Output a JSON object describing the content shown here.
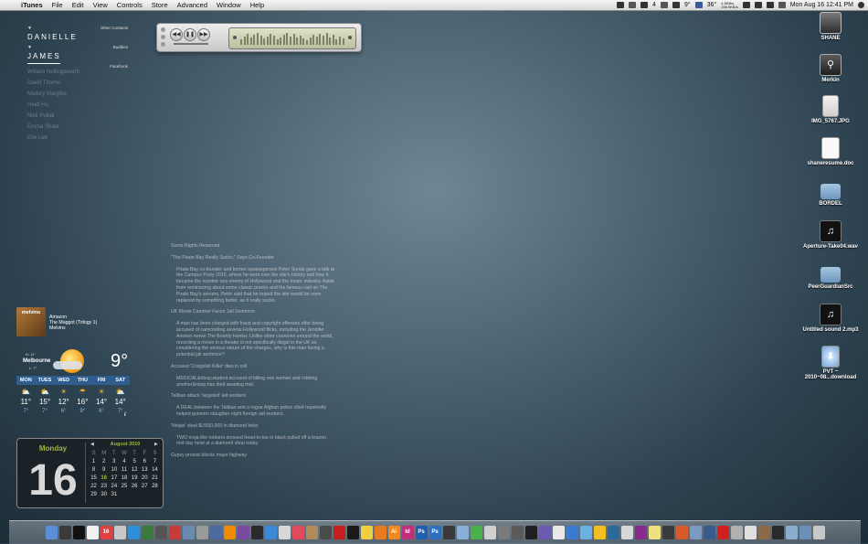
{
  "menubar": {
    "apple": "",
    "app": "iTunes",
    "items": [
      "File",
      "Edit",
      "View",
      "Controls",
      "Store",
      "Advanced",
      "Window",
      "Help"
    ],
    "right": {
      "badge": "4",
      "temp": "9°",
      "cpu": "36°",
      "net_up": "4.5KB/s",
      "net_down": "156.9KB/s",
      "clock": "Mon Aug 16  12:41 PM"
    }
  },
  "itunes_widget": {
    "controls": [
      "prev",
      "pause",
      "next"
    ]
  },
  "left_menu": {
    "names": [
      "DANIELLE",
      "JAMES"
    ],
    "friends": [
      "William Hollingsworth",
      "David Thorne",
      "Mallory Margitta",
      "Heidi Hu",
      "Nick Pollak",
      "Emma Shaw",
      "Eve Lee"
    ],
    "right_col": [
      "Other Contacts",
      "Buddies",
      "Facebook"
    ]
  },
  "news": [
    {
      "type": "h",
      "text": "Some Rights Reserved"
    },
    {
      "type": "h",
      "text": "\"The Pirate Bay Really Sucks,\" Says Co-Founder"
    },
    {
      "type": "b",
      "text": "Pirate Bay co-founder and former spokesperson Peter Sunde gave a talk at the Campus Party 2010, where he went over the site's history and how it became the number one enemy of Hollywood and the music industry. Aside from reminiscing about some classic pranks and the famous raid on The Pirate Bay's servers, Peter said that he hoped the site would be soon replaced by something better, as it really sucks."
    },
    {
      "type": "h",
      "text": "UK Movie Cammer Faces Jail Sentence"
    },
    {
      "type": "b",
      "text": "A man has been charged with fraud and copyright offenses after being accused of camcording several Hollywood flicks, including the Jennifer Aniston movie The Bounty Hunter. Unlike other countries around the world, recording a movie in a theater is not specifically illegal in the UK so considering the serious nature of the charges, why is this man facing a potential jail sentence?"
    },
    {
      "type": "h",
      "text": "Accused 'Craigslist Killer' dies in cell"
    },
    {
      "type": "b",
      "text": "MEDICAL&nbsp;student accused of killing one woman and robbing another&nbsp;has died awaiting trial."
    },
    {
      "type": "h",
      "text": "Taliban attack 'targeted' aid workers"
    },
    {
      "type": "b",
      "text": "A DEAL between the Taliban and a rogue Afghan police chief reportedly helped gunmen slaughter eight foreign aid workers."
    },
    {
      "type": "h",
      "text": "'Ninjas' steal $US60,000 in diamond heist"
    },
    {
      "type": "b",
      "text": "TWO ninja-like robbers dressed head-to-toe in black pulled off a brazen, mid-day heist at a diamond shop today."
    },
    {
      "type": "h",
      "text": "Gypsy protest blocks major highway"
    }
  ],
  "music": {
    "album_art": "melvins",
    "source": "Amazon",
    "album": "The Maggot (Trilogy 1)",
    "artist": "Melvins"
  },
  "weather": {
    "city": "Melbourne",
    "hi": "H: 11°",
    "lo": "L: 7°",
    "temp": "9°",
    "days": [
      "MON",
      "TUES",
      "WED",
      "THU",
      "FRI",
      "SAT"
    ],
    "highs": [
      "11°",
      "15°",
      "12°",
      "16°",
      "14°",
      "14°"
    ],
    "lows": [
      "7°",
      "7°",
      "6°",
      "9°",
      "6°",
      "7°"
    ],
    "icons": [
      "sun-cloud",
      "sun-cloud",
      "sun",
      "rain",
      "sun",
      "sun-cloud"
    ],
    "info": "i"
  },
  "calendar": {
    "day_name": "Monday",
    "day_num": "16",
    "month": "August 2010",
    "headers": [
      "S",
      "M",
      "T",
      "W",
      "T",
      "F",
      "S"
    ],
    "days": [
      "1",
      "2",
      "3",
      "4",
      "5",
      "6",
      "7",
      "8",
      "9",
      "10",
      "11",
      "12",
      "13",
      "14",
      "15",
      "16",
      "17",
      "18",
      "19",
      "20",
      "21",
      "22",
      "23",
      "24",
      "25",
      "26",
      "27",
      "28",
      "29",
      "30",
      "31"
    ],
    "first_weekday": 0,
    "today": "16"
  },
  "desktop_icons": [
    {
      "label": "SHANE",
      "kind": "drive",
      "glyph": ""
    },
    {
      "label": "Merkin",
      "kind": "usb",
      "glyph": "⚲"
    },
    {
      "label": "IMG_5767.JPG",
      "kind": "photo",
      "glyph": ""
    },
    {
      "label": "shaneresume.doc",
      "kind": "doc",
      "glyph": ""
    },
    {
      "label": "BORDEL",
      "kind": "folder",
      "glyph": ""
    },
    {
      "label": "Aperture-Take04.wav",
      "kind": "audio",
      "glyph": "♫"
    },
    {
      "label": "PeerGuardianSrc",
      "kind": "folder",
      "glyph": ""
    },
    {
      "label": "Untitled sound 2.mp3",
      "kind": "audio",
      "glyph": "♫"
    },
    {
      "label": "PVT ~ 2010~08...download",
      "kind": "dl",
      "glyph": "⬇"
    }
  ],
  "dock": {
    "items": [
      {
        "name": "finder",
        "color": "#5a8fd6",
        "glyph": ""
      },
      {
        "name": "dashboard",
        "color": "#3a3a3a",
        "glyph": ""
      },
      {
        "name": "terminal",
        "color": "#111111",
        "glyph": ""
      },
      {
        "name": "textedit",
        "color": "#f0f0f0",
        "glyph": ""
      },
      {
        "name": "ical",
        "color": "#e04040",
        "glyph": "16"
      },
      {
        "name": "app-6",
        "color": "#c8c8c8",
        "glyph": ""
      },
      {
        "name": "app-7",
        "color": "#2e8fd8",
        "glyph": ""
      },
      {
        "name": "app-8",
        "color": "#3a7a3a",
        "glyph": ""
      },
      {
        "name": "app-9",
        "color": "#555555",
        "glyph": ""
      },
      {
        "name": "app-10",
        "color": "#c83a3a",
        "glyph": ""
      },
      {
        "name": "app-11",
        "color": "#6a8ab0",
        "glyph": ""
      },
      {
        "name": "app-12",
        "color": "#9a9a9a",
        "glyph": ""
      },
      {
        "name": "app-13",
        "color": "#4a6aa0",
        "glyph": ""
      },
      {
        "name": "vlc",
        "color": "#f08a00",
        "glyph": ""
      },
      {
        "name": "app-15",
        "color": "#7a4aa0",
        "glyph": ""
      },
      {
        "name": "app-16",
        "color": "#2a2a2a",
        "glyph": ""
      },
      {
        "name": "app-17",
        "color": "#3a8ad8",
        "glyph": ""
      },
      {
        "name": "app-18",
        "color": "#d8d8d8",
        "glyph": ""
      },
      {
        "name": "app-19",
        "color": "#e04a5a",
        "glyph": ""
      },
      {
        "name": "app-20",
        "color": "#b08a5a",
        "glyph": ""
      },
      {
        "name": "app-21",
        "color": "#4a4a4a",
        "glyph": ""
      },
      {
        "name": "acrobat",
        "color": "#c81e1e",
        "glyph": ""
      },
      {
        "name": "app-23",
        "color": "#1a1a1a",
        "glyph": ""
      },
      {
        "name": "app-24",
        "color": "#f0d040",
        "glyph": ""
      },
      {
        "name": "app-25",
        "color": "#e87a20",
        "glyph": ""
      },
      {
        "name": "illustrator",
        "color": "#f08a20",
        "glyph": "Ai"
      },
      {
        "name": "indesign",
        "color": "#c0307a",
        "glyph": "Id"
      },
      {
        "name": "photoshop",
        "color": "#1f5fb0",
        "glyph": "Ps"
      },
      {
        "name": "photoshop-2",
        "color": "#2f6fc0",
        "glyph": "Ps"
      },
      {
        "name": "app-30",
        "color": "#3a3a3a",
        "glyph": ""
      },
      {
        "name": "app-31",
        "color": "#8ab0d8",
        "glyph": ""
      },
      {
        "name": "app-32",
        "color": "#4ab04a",
        "glyph": ""
      },
      {
        "name": "app-33",
        "color": "#d0d0d0",
        "glyph": ""
      },
      {
        "name": "app-34",
        "color": "#7a7a7a",
        "glyph": ""
      },
      {
        "name": "app-35",
        "color": "#5a5a5a",
        "glyph": ""
      },
      {
        "name": "app-36",
        "color": "#202020",
        "glyph": ""
      },
      {
        "name": "app-37",
        "color": "#6a5ab0",
        "glyph": ""
      },
      {
        "name": "app-38",
        "color": "#e8e8e8",
        "glyph": ""
      },
      {
        "name": "app-39",
        "color": "#3a7ad0",
        "glyph": ""
      },
      {
        "name": "app-40",
        "color": "#6ab0e0",
        "glyph": ""
      },
      {
        "name": "app-41",
        "color": "#f0c020",
        "glyph": ""
      },
      {
        "name": "app-42",
        "color": "#2a6a9a",
        "glyph": ""
      },
      {
        "name": "app-43",
        "color": "#d8d8d8",
        "glyph": ""
      },
      {
        "name": "app-44",
        "color": "#8a2a8a",
        "glyph": ""
      },
      {
        "name": "app-45",
        "color": "#f0e080",
        "glyph": ""
      },
      {
        "name": "app-46",
        "color": "#3a3a3a",
        "glyph": ""
      },
      {
        "name": "app-47",
        "color": "#d85a2a",
        "glyph": ""
      },
      {
        "name": "app-48",
        "color": "#7a9ac0",
        "glyph": ""
      },
      {
        "name": "app-49",
        "color": "#3a5a8a",
        "glyph": ""
      },
      {
        "name": "app-50",
        "color": "#d02020",
        "glyph": ""
      },
      {
        "name": "app-51",
        "color": "#b0b0b0",
        "glyph": ""
      },
      {
        "name": "app-52",
        "color": "#e0e0e0",
        "glyph": ""
      },
      {
        "name": "app-53",
        "color": "#8a6a4a",
        "glyph": ""
      },
      {
        "name": "app-54",
        "color": "#2a2a2a",
        "glyph": ""
      },
      {
        "name": "downloads-stack",
        "color": "#8aaed0",
        "glyph": ""
      },
      {
        "name": "documents-stack",
        "color": "#6a90b8",
        "glyph": ""
      },
      {
        "name": "trash",
        "color": "#c8c8c8",
        "glyph": ""
      }
    ]
  }
}
